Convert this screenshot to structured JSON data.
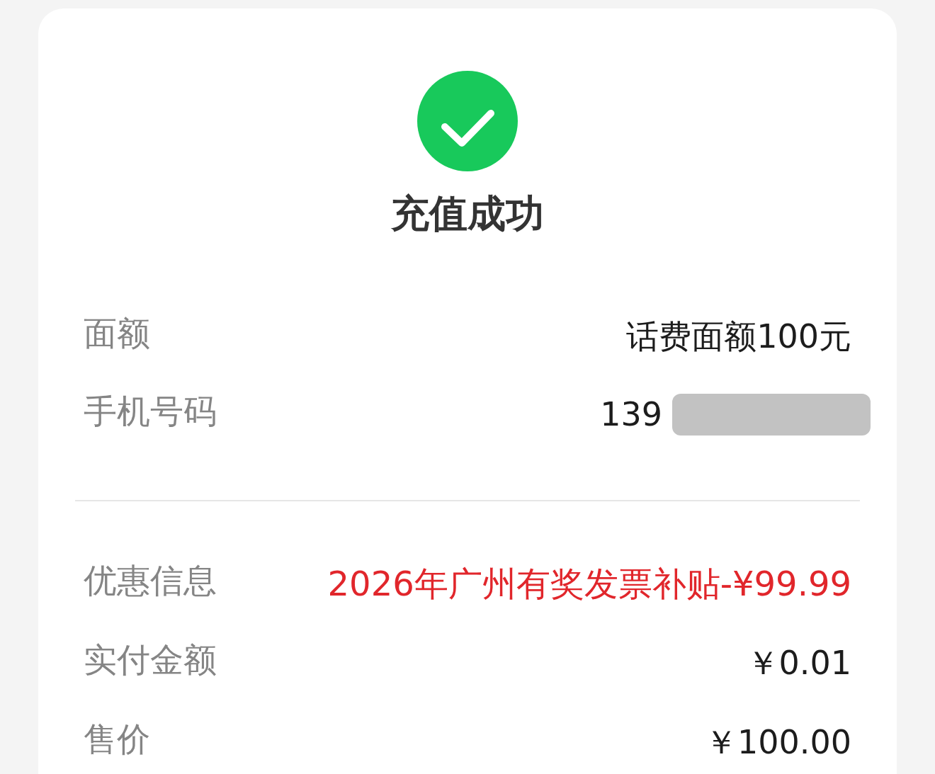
{
  "status": {
    "kind": "success",
    "title": "充值成功"
  },
  "sections": [
    {
      "rows": [
        {
          "label": "面额",
          "value": "话费面额100元",
          "highlight": false,
          "masked": false
        },
        {
          "label": "手机号码",
          "value": "139",
          "highlight": false,
          "masked": true
        }
      ]
    },
    {
      "rows": [
        {
          "label": "优惠信息",
          "value": "2026年广州有奖发票补贴-¥99.99",
          "highlight": true,
          "masked": false
        },
        {
          "label": "实付金额",
          "value": "￥0.01",
          "highlight": false,
          "masked": false
        },
        {
          "label": "售价",
          "value": "￥100.00",
          "highlight": false,
          "masked": false
        }
      ]
    }
  ]
}
